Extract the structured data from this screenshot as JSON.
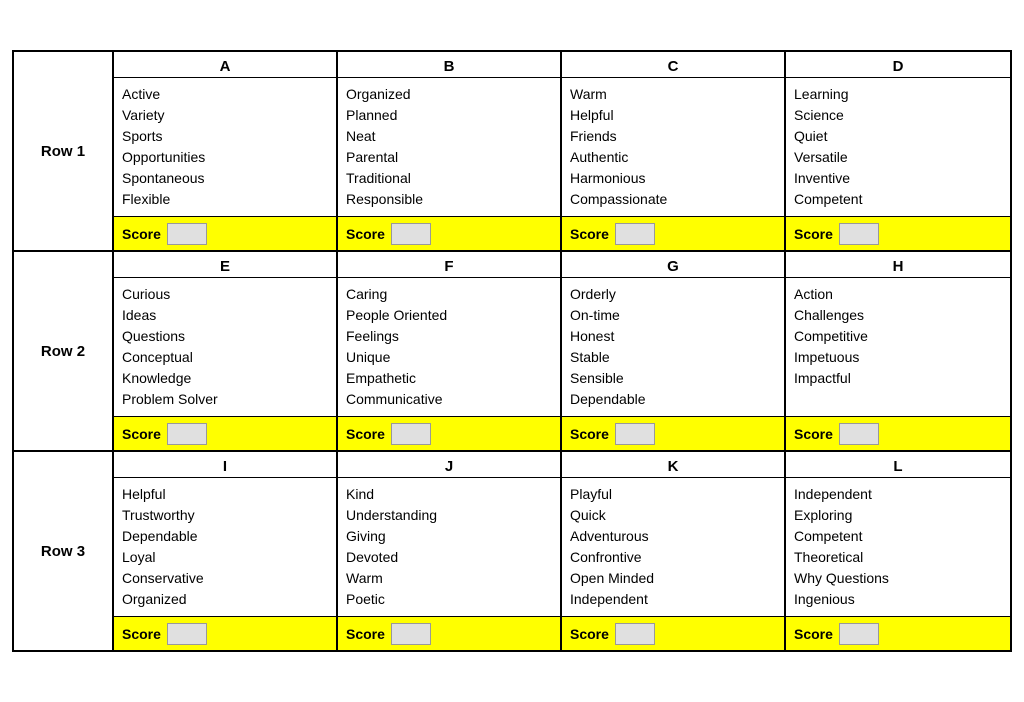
{
  "rows": [
    {
      "label": "Row 1",
      "cells": [
        {
          "header": "A",
          "items": [
            "Active",
            "Variety",
            "Sports",
            "Opportunities",
            "Spontaneous",
            "Flexible"
          ]
        },
        {
          "header": "B",
          "items": [
            "Organized",
            "Planned",
            "Neat",
            "Parental",
            "Traditional",
            "Responsible"
          ]
        },
        {
          "header": "C",
          "items": [
            "Warm",
            "Helpful",
            "Friends",
            "Authentic",
            "Harmonious",
            "Compassionate"
          ]
        },
        {
          "header": "D",
          "items": [
            "Learning",
            "Science",
            "Quiet",
            "Versatile",
            "Inventive",
            "Competent"
          ]
        }
      ]
    },
    {
      "label": "Row 2",
      "cells": [
        {
          "header": "E",
          "items": [
            "Curious",
            "Ideas",
            "Questions",
            "Conceptual",
            "Knowledge",
            "Problem Solver"
          ]
        },
        {
          "header": "F",
          "items": [
            "Caring",
            "People Oriented",
            "Feelings",
            "Unique",
            "Empathetic",
            "Communicative"
          ]
        },
        {
          "header": "G",
          "items": [
            "Orderly",
            "On-time",
            "Honest",
            "Stable",
            "Sensible",
            "Dependable"
          ]
        },
        {
          "header": "H",
          "items": [
            "Action",
            "Challenges",
            "Competitive",
            "Impetuous",
            "Impactful"
          ]
        }
      ]
    },
    {
      "label": "Row 3",
      "cells": [
        {
          "header": "I",
          "items": [
            "Helpful",
            "Trustworthy",
            "Dependable",
            "Loyal",
            "Conservative",
            "Organized"
          ]
        },
        {
          "header": "J",
          "items": [
            "Kind",
            "Understanding",
            "Giving",
            "Devoted",
            "Warm",
            "Poetic"
          ]
        },
        {
          "header": "K",
          "items": [
            "Playful",
            "Quick",
            "Adventurous",
            "Confrontive",
            "Open Minded",
            "Independent"
          ]
        },
        {
          "header": "L",
          "items": [
            "Independent",
            "Exploring",
            "Competent",
            "Theoretical",
            "Why Questions",
            "Ingenious"
          ]
        }
      ]
    }
  ],
  "score_label": "Score"
}
